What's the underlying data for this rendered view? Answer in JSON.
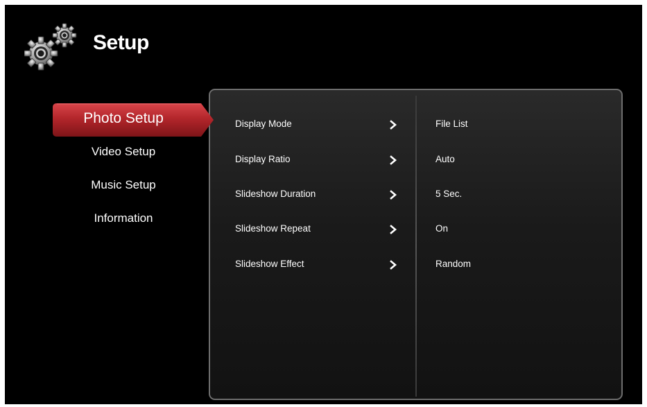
{
  "header": {
    "icon": "gears-icon",
    "title": "Setup"
  },
  "sidebar": {
    "items": [
      {
        "label": "Photo Setup",
        "active": true
      },
      {
        "label": "Video Setup",
        "active": false
      },
      {
        "label": "Music Setup",
        "active": false
      },
      {
        "label": "Information",
        "active": false
      }
    ]
  },
  "settings": {
    "rows": [
      {
        "label": "Display Mode",
        "value": "File List"
      },
      {
        "label": "Display Ratio",
        "value": "Auto"
      },
      {
        "label": "Slideshow Duration",
        "value": "5 Sec."
      },
      {
        "label": "Slideshow Repeat",
        "value": "On"
      },
      {
        "label": "Slideshow Effect",
        "value": "Random"
      }
    ],
    "arrow_icon": "chevron-right-icon"
  },
  "colors": {
    "background": "#000000",
    "active_tab": "#b3262b",
    "panel_border": "#6e6e6e",
    "text": "#ffffff"
  }
}
